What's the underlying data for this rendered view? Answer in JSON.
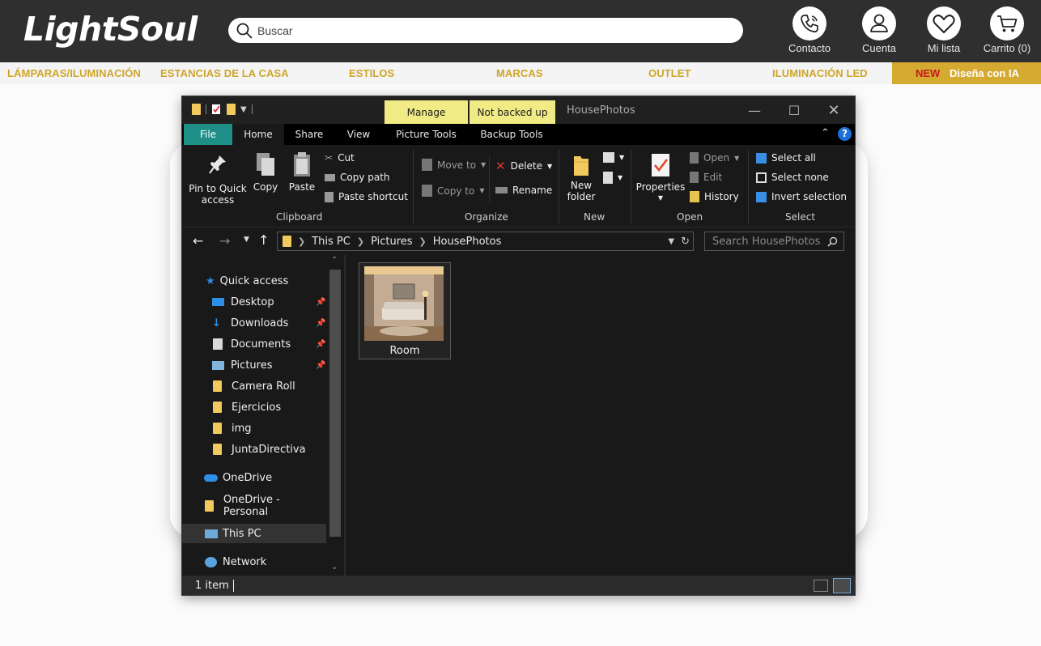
{
  "site": {
    "logo": "LightSoul",
    "search_placeholder": "Buscar",
    "header_items": [
      {
        "label": "Contacto",
        "icon": "phone-icon"
      },
      {
        "label": "Cuenta",
        "icon": "user-icon"
      },
      {
        "label": "Mi lista",
        "icon": "heart-icon"
      },
      {
        "label": "Carrito (0)",
        "icon": "cart-icon"
      }
    ],
    "nav": [
      "LÁMPARAS/ILUMINACIÓN",
      "ESTANCIAS DE LA CASA",
      "ESTILOS",
      "MARCAS",
      "OUTLET",
      "ILUMINACIÓN LED"
    ],
    "nav_ai": {
      "badge": "NEW",
      "label": "Diseña con IA"
    },
    "colors": {
      "header_bg": "#2f2f2f",
      "accent_gold": "#d4aa31",
      "badge_red": "#c31b1b"
    }
  },
  "explorer": {
    "title": "HousePhotos",
    "context_tabs": [
      "Manage",
      "Not backed up"
    ],
    "tabs": [
      "File",
      "Home",
      "Share",
      "View",
      "Picture Tools",
      "Backup Tools"
    ],
    "ribbon": {
      "clipboard": {
        "group": "Clipboard",
        "pin": "Pin to Quick access",
        "copy": "Copy",
        "paste": "Paste",
        "cut": "Cut",
        "copy_path": "Copy path",
        "paste_shortcut": "Paste shortcut"
      },
      "organize": {
        "group": "Organize",
        "move_to": "Move to",
        "copy_to": "Copy to",
        "delete": "Delete",
        "rename": "Rename"
      },
      "new": {
        "group": "New",
        "new_folder": "New folder"
      },
      "open": {
        "group": "Open",
        "properties": "Properties",
        "open": "Open",
        "edit": "Edit",
        "history": "History"
      },
      "select": {
        "group": "Select",
        "select_all": "Select all",
        "select_none": "Select none",
        "invert": "Invert selection"
      }
    },
    "breadcrumb": [
      "This PC",
      "Pictures",
      "HousePhotos"
    ],
    "search_placeholder": "Search HousePhotos",
    "nav_pane": {
      "quick_access": "Quick access",
      "pinned": [
        "Desktop",
        "Downloads",
        "Documents",
        "Pictures"
      ],
      "folders": [
        "Camera Roll",
        "Ejercicios",
        "img",
        "JuntaDirectiva"
      ],
      "onedrive": "OneDrive",
      "onedrive_personal": "OneDrive - Personal",
      "this_pc": "This PC",
      "network": "Network"
    },
    "files": [
      {
        "name": "Room"
      }
    ],
    "status": "1 item"
  }
}
